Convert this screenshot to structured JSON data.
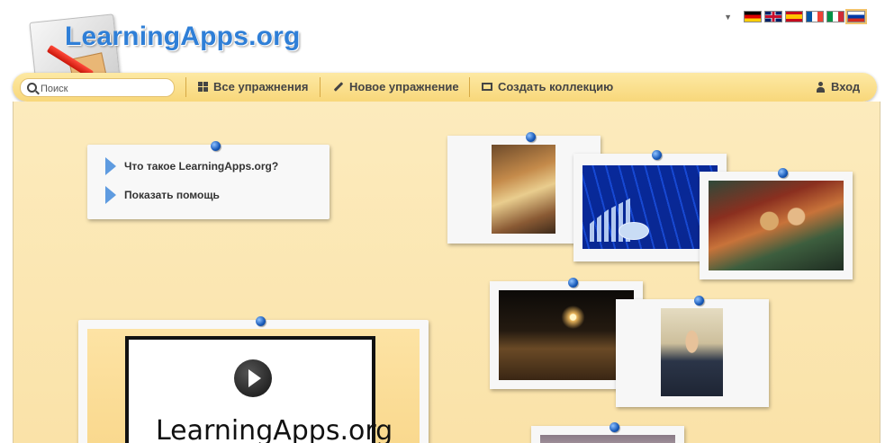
{
  "header": {
    "logo_text": "LearningApps.org",
    "languages": [
      {
        "code": "de",
        "name": "Deutsch"
      },
      {
        "code": "en",
        "name": "English"
      },
      {
        "code": "es",
        "name": "Español"
      },
      {
        "code": "fr",
        "name": "Français"
      },
      {
        "code": "it",
        "name": "Italiano"
      },
      {
        "code": "ru",
        "name": "Русский",
        "selected": true
      }
    ],
    "lang_dropdown_icon": "triangle-down-icon"
  },
  "toolbar": {
    "search_placeholder": "Поиск",
    "all_exercises": "Все упражнения",
    "new_exercise": "Новое упражнение",
    "create_collection": "Создать коллекцию",
    "login": "Вход"
  },
  "help": {
    "what_is": "Что такое LearningApps.org?",
    "show_help": "Показать помощь"
  },
  "video": {
    "title": "LearningApps.org"
  },
  "colors": {
    "accent_blue": "#2f7fd7",
    "toolbar_yellow": "#f8d77a",
    "board_background": "#fbe6b1",
    "pin_blue": "#1658b8"
  }
}
